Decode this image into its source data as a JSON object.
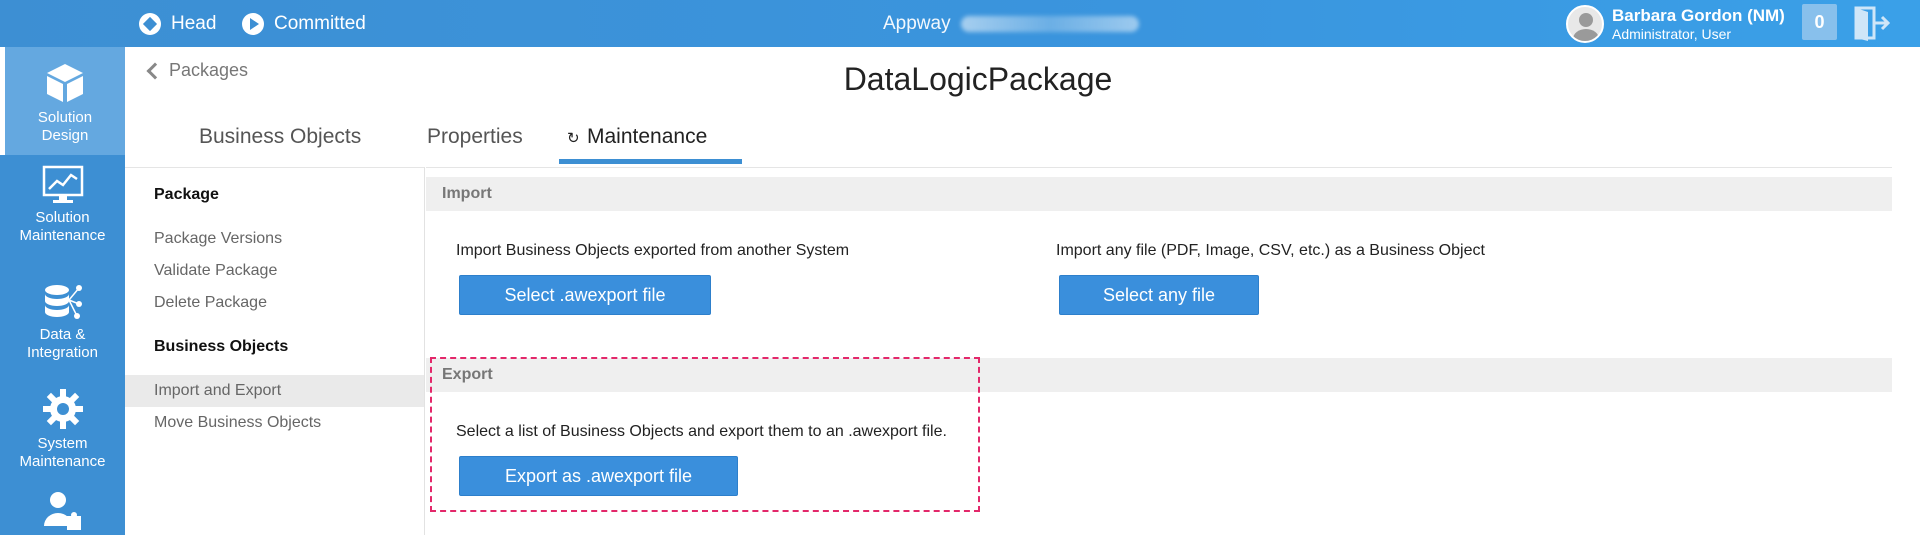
{
  "topbar": {
    "head_label": "Head",
    "committed_label": "Committed",
    "app_title": "Appway",
    "user_name": "Barbara Gordon (NM)",
    "user_role": "Administrator, User",
    "counter": "0"
  },
  "leftnav": {
    "items": [
      {
        "label_line1": "Solution",
        "label_line2": "Design"
      },
      {
        "label_line1": "Solution",
        "label_line2": "Maintenance"
      },
      {
        "label_line1": "Data &",
        "label_line2": "Integration"
      },
      {
        "label_line1": "System",
        "label_line2": "Maintenance"
      }
    ]
  },
  "header": {
    "back_label": "Packages",
    "title": "DataLogicPackage",
    "tabs": [
      {
        "label": "Business Objects"
      },
      {
        "label": "Properties"
      },
      {
        "label": "Maintenance"
      }
    ]
  },
  "sidebar": {
    "package_heading": "Package",
    "package_items": [
      "Package Versions",
      "Validate Package",
      "Delete Package"
    ],
    "bo_heading": "Business Objects",
    "bo_items": [
      "Import and Export",
      "Move Business Objects"
    ]
  },
  "content": {
    "import": {
      "heading": "Import",
      "awexport_desc": "Import Business Objects exported from another System",
      "awexport_button": "Select .awexport file",
      "any_desc": "Import any file (PDF, Image, CSV, etc.) as a Business Object",
      "any_button": "Select any file"
    },
    "export": {
      "heading": "Export",
      "desc": "Select a list of Business Objects and export them to an .awexport file.",
      "button": "Export as .awexport file"
    }
  }
}
